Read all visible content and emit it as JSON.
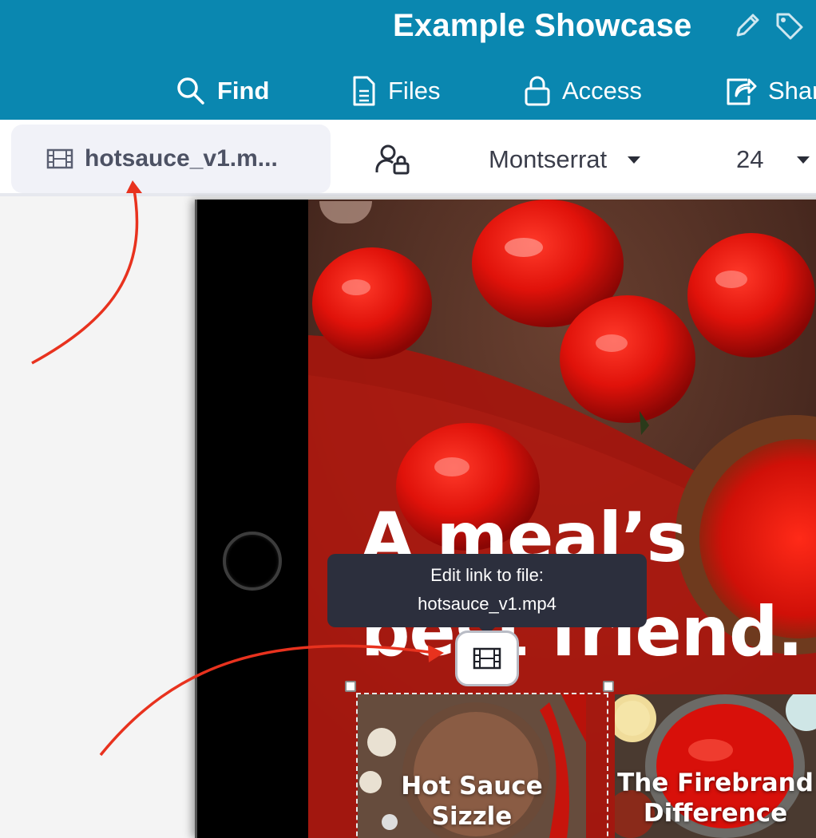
{
  "header": {
    "doc_title": "Example Showcase",
    "icons": [
      "pencil-icon",
      "tag-icon"
    ],
    "nav": [
      {
        "label": "Find",
        "icon": "search-icon"
      },
      {
        "label": "Files",
        "icon": "document-icon"
      },
      {
        "label": "Access",
        "icon": "lock-icon"
      },
      {
        "label": "Share",
        "icon": "share-icon"
      }
    ],
    "background": "#0a87b0"
  },
  "toolbar": {
    "file_chip_label": "hotsauce_v1.m...",
    "file_chip_icon": "film-icon",
    "access_icon": "user-lock-icon",
    "font_family_value": "Montserrat",
    "font_size_value": "24"
  },
  "canvas": {
    "heading_line1": "A meal’s",
    "heading_line2": "best friend.",
    "cards": [
      {
        "title_line1": "Hot Sauce",
        "title_line2": "Sizzle"
      },
      {
        "title_line1": "The Firebrand",
        "title_line2": "Difference"
      }
    ]
  },
  "tooltip": {
    "line1": "Edit link to file:",
    "line2": "hotsauce_v1.mp4"
  },
  "annotation_color": "#e8321e"
}
